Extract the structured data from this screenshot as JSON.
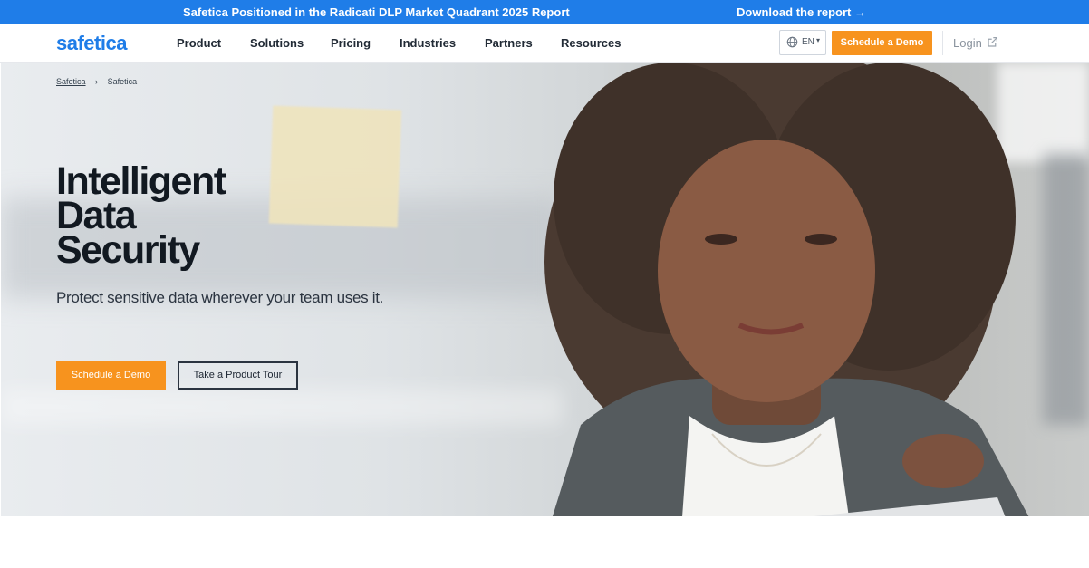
{
  "announcement": {
    "left_text": "Safetica Positioned in the Radicati DLP Market Quadrant 2025 Report",
    "right_text": "Download the report →"
  },
  "navbar": {
    "logo": "safetica",
    "menu": [
      "Product",
      "Solutions",
      "Pricing",
      "Industries",
      "Partners",
      "Resources"
    ],
    "language": "EN",
    "demo_label": "Schedule a Demo",
    "login_label": "Login",
    "icons": {
      "language": "globe-icon",
      "caret": "chevron-down-icon",
      "login": "external-link-icon"
    }
  },
  "breadcrumb": {
    "items": [
      "Safetica",
      "Safetica"
    ]
  },
  "hero": {
    "title_lines": [
      "Intelligent",
      "Data",
      "Security"
    ],
    "subtitle": "Protect sensitive data wherever your team uses it.",
    "primary_button": "Schedule a Demo",
    "secondary_button": "Take a Product Tour"
  },
  "colors": {
    "brand_blue": "#1f7de8",
    "accent_orange": "#f7931e",
    "heading": "#121921"
  }
}
